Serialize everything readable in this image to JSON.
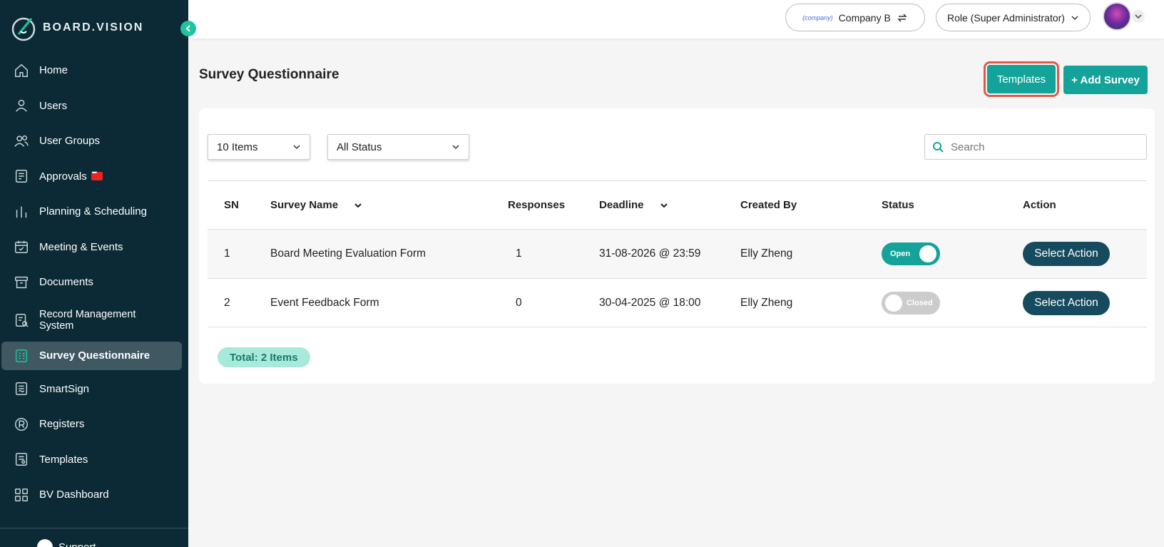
{
  "brand": {
    "name": "BOARD.VISION",
    "accent": "#1ec3a0",
    "sidebar_bg": "#0b2a36"
  },
  "sidebar": {
    "items": [
      {
        "label": "Home",
        "icon": "home-icon"
      },
      {
        "label": "Users",
        "icon": "user-icon"
      },
      {
        "label": "User Groups",
        "icon": "users-icon"
      },
      {
        "label": "Approvals",
        "icon": "approval-icon"
      },
      {
        "label": "Planning & Scheduling",
        "icon": "bar-chart-icon"
      },
      {
        "label": "Meeting & Events",
        "icon": "calendar-check-icon"
      },
      {
        "label": "Documents",
        "icon": "archive-icon"
      },
      {
        "label": "Record Management System",
        "icon": "record-search-icon"
      },
      {
        "label": "Survey Questionnaire",
        "icon": "survey-icon",
        "active": true
      },
      {
        "label": "SmartSign",
        "icon": "sign-icon"
      },
      {
        "label": "Registers",
        "icon": "registered-icon"
      },
      {
        "label": "Templates",
        "icon": "template-icon"
      },
      {
        "label": "BV Dashboard",
        "icon": "grid-icon"
      }
    ],
    "support_label": "Support"
  },
  "topbar": {
    "company_logo_text": "(company)",
    "company_label": "Company B",
    "role_label": "Role (Super Administrator)"
  },
  "main": {
    "title": "Survey Questionnaire",
    "templates_button": "Templates",
    "add_button": "+ Add Survey",
    "items_select": "10 Items",
    "status_select": "All Status",
    "search_placeholder": "Search",
    "columns": {
      "sn": "SN",
      "name": "Survey Name",
      "responses": "Responses",
      "deadline": "Deadline",
      "created_by": "Created By",
      "status": "Status",
      "action": "Action"
    },
    "rows": [
      {
        "sn": "1",
        "name": "Board Meeting Evaluation Form",
        "responses": "1",
        "deadline": "31-08-2026 @ 23:59",
        "created_by": "Elly Zheng",
        "status": "Open",
        "action": "Select Action"
      },
      {
        "sn": "2",
        "name": "Event Feedback Form",
        "responses": "0",
        "deadline": "30-04-2025 @ 18:00",
        "created_by": "Elly Zheng",
        "status": "Closed",
        "action": "Select Action"
      }
    ],
    "total": "Total: 2 Items"
  },
  "colors": {
    "teal": "#14a39a",
    "action_dark": "#164a5e",
    "highlight": "#e05a45"
  }
}
